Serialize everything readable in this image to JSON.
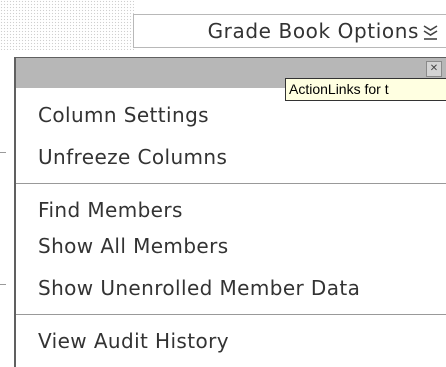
{
  "toolbar": {
    "options_label": "Grade Book Options",
    "options_icon": "double-chevron-down-icon"
  },
  "tooltip": {
    "text": "ActionLinks for t"
  },
  "menu": {
    "close_icon": "close-icon",
    "groups": [
      [
        "Column Settings",
        "Unfreeze Columns"
      ],
      [
        "Find Members",
        "Show All Members",
        "Show Unenrolled Member Data"
      ],
      [
        "View Audit History"
      ]
    ]
  }
}
